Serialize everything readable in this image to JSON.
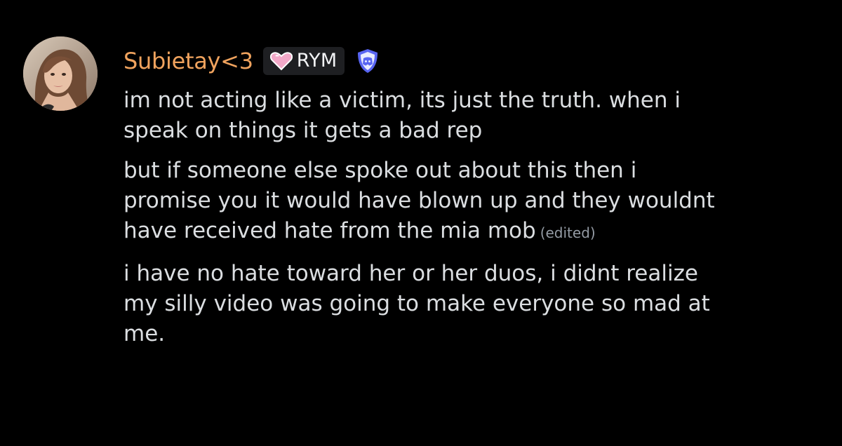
{
  "user": {
    "username": "Subietay<3",
    "username_color": "#f0a35e",
    "avatar_icon": "user-avatar-photo",
    "server_tag": {
      "label": "RYM",
      "icon": "pink-heart-icon"
    },
    "badge_icon": "discord-shield-badge-icon"
  },
  "messages": [
    {
      "text": "im not acting like a victim, its just the truth. when i\nspeak on things it gets a bad rep",
      "edited": false
    },
    {
      "text": "but if someone else spoke out about this then i\npromise you it would have blown up and they wouldnt\nhave received hate from the mia mob",
      "edited": true,
      "edited_label": "(edited)"
    },
    {
      "text": "i have no hate toward her or her duos, i didnt realize\nmy silly video was going to make everyone so mad at\nme.",
      "edited": false
    }
  ],
  "colors": {
    "background": "#000000",
    "text": "#dbdee1",
    "muted": "#949ba4",
    "tag_background": "#1e1f22",
    "badge": "#5865f2"
  }
}
